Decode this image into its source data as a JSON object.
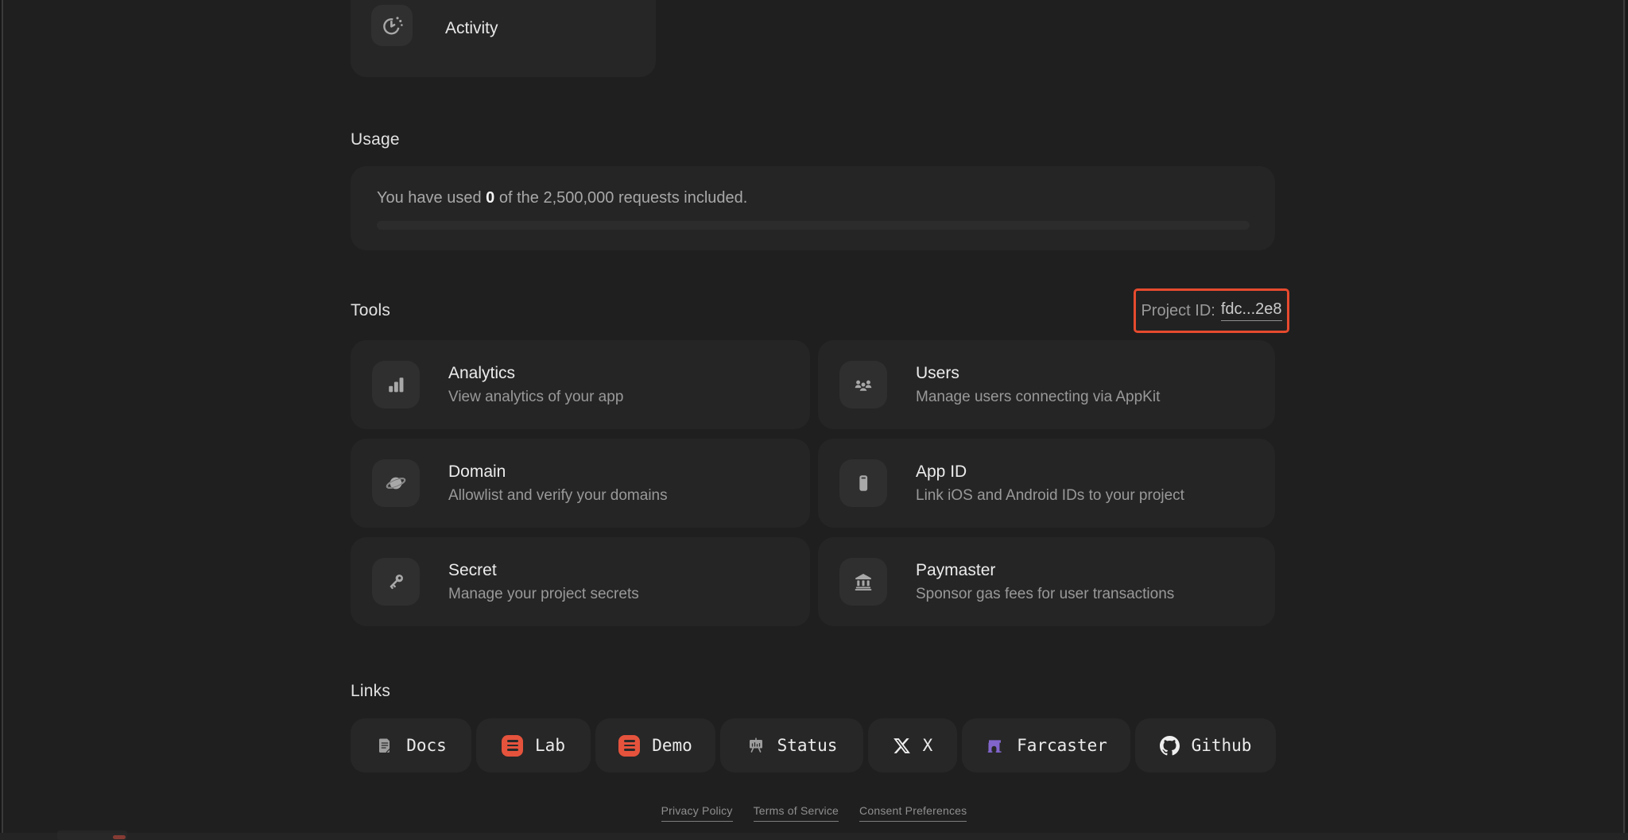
{
  "activity_card": {
    "label": "Activity",
    "icon": "timer-icon"
  },
  "usage": {
    "heading": "Usage",
    "message_prefix": "You have used ",
    "used_value": "0",
    "message_suffix": " of the 2,500,000 requests included.",
    "progress_percent": 0
  },
  "tools": {
    "heading": "Tools",
    "project_id": {
      "label": "Project ID:",
      "value": "fdc...2e8"
    },
    "cards": [
      {
        "title": "Analytics",
        "subtitle": "View analytics of your app",
        "icon": "bar-chart-icon"
      },
      {
        "title": "Users",
        "subtitle": "Manage users connecting via AppKit",
        "icon": "users-icon"
      },
      {
        "title": "Domain",
        "subtitle": "Allowlist and verify your domains",
        "icon": "planet-icon"
      },
      {
        "title": "App ID",
        "subtitle": "Link iOS and Android IDs to your project",
        "icon": "phone-icon"
      },
      {
        "title": "Secret",
        "subtitle": "Manage your project secrets",
        "icon": "key-icon"
      },
      {
        "title": "Paymaster",
        "subtitle": "Sponsor gas fees for user transactions",
        "icon": "bank-icon"
      }
    ]
  },
  "links": {
    "heading": "Links",
    "items": [
      {
        "label": "Docs",
        "icon": "doc-icon"
      },
      {
        "label": "Lab",
        "icon": "reown-logo-icon"
      },
      {
        "label": "Demo",
        "icon": "reown-logo-icon"
      },
      {
        "label": "Status",
        "icon": "presentation-icon"
      },
      {
        "label": "X",
        "icon": "x-logo-icon"
      },
      {
        "label": "Farcaster",
        "icon": "farcaster-logo-icon"
      },
      {
        "label": "Github",
        "icon": "github-logo-icon"
      }
    ]
  },
  "footer": {
    "links": [
      "Privacy Policy",
      "Terms of Service",
      "Consent Preferences"
    ]
  },
  "colors": {
    "page_bg": "#1f1f1f",
    "card_bg": "#252525",
    "icon_square_bg": "#2f2f2f",
    "icon_glyph": "#a8a8a8",
    "highlight_red": "#e64a2e",
    "reown_orange": "#e5533d",
    "farcaster_purple": "#8165cb"
  }
}
